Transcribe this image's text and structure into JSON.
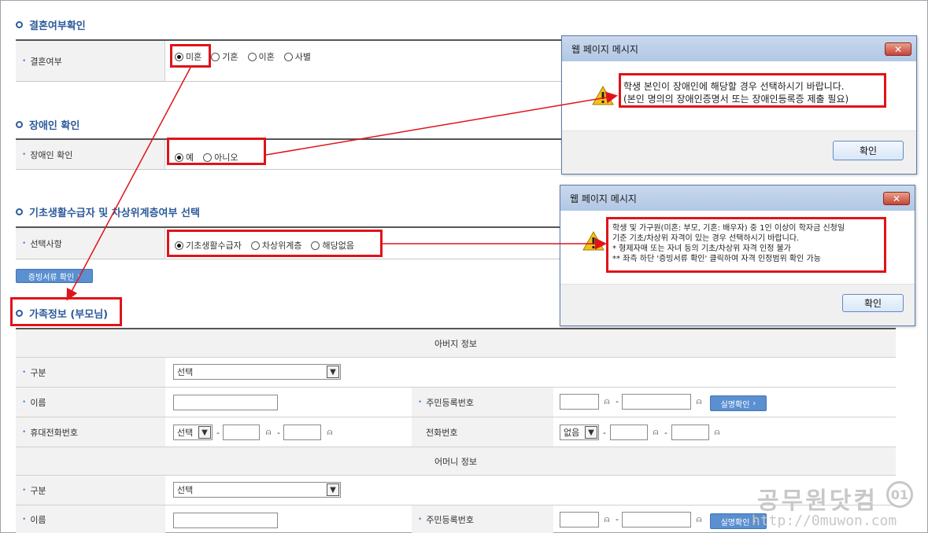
{
  "marriage": {
    "title": "결혼여부확인",
    "label": "결혼여부",
    "options": [
      "미혼",
      "기혼",
      "이혼",
      "사별"
    ]
  },
  "disability": {
    "title": "장애인 확인",
    "label": "장애인 확인",
    "options": [
      "예",
      "아니오"
    ]
  },
  "basic": {
    "title": "기초생활수급자 및 차상위계층여부 선택",
    "label": "선택사항",
    "options": [
      "기초생활수급자",
      "차상위계층",
      "해당없음"
    ],
    "evidence_button": "증빙서류 확인"
  },
  "dialog1": {
    "title": "웹 페이지 메시지",
    "close": "✕",
    "line1": "학생 본인이 장애인에 해당할 경우 선택하시기 바랍니다.",
    "line2": "(본인 명의의 장애인증명서 또는 장애인등록증 제출 필요)",
    "ok": "확인"
  },
  "dialog2": {
    "title": "웹 페이지 메시지",
    "close": "✕",
    "line1": "학생 및 가구원(미혼: 부모, 기혼: 배우자) 중 1인 이상이 학자금 신청일",
    "line2": "기준 기초/차상위 자격이 있는 경우 선택하시기 바랍니다.",
    "line3": "* 형제자매 또는 자녀 등의 기초/차상위 자격 인정 불가",
    "line4": "** 좌측 하단 '증빙서류 확인' 클릭하여 자격 인정범위 확인 가능",
    "ok": "확인"
  },
  "family": {
    "title": "가족정보 (부모님)",
    "father_header": "아버지 정보",
    "mother_header": "어머니 정보",
    "type_label": "구분",
    "type_value": "선택",
    "name_label": "이름",
    "rrn_label": "주민등록번호",
    "verify_button": "실명확인",
    "mobile_label": "휴대전화번호",
    "mobile_select": "선택",
    "phone_label": "전화번호",
    "phone_select": "없음",
    "dash": "-"
  },
  "watermark": {
    "name": "공무원닷컴",
    "url": "http://0muwon.com",
    "badge": "01"
  },
  "colors": {
    "accent": "#2d5b9a",
    "highlight": "#e0131a",
    "button": "#5a8fd0"
  }
}
